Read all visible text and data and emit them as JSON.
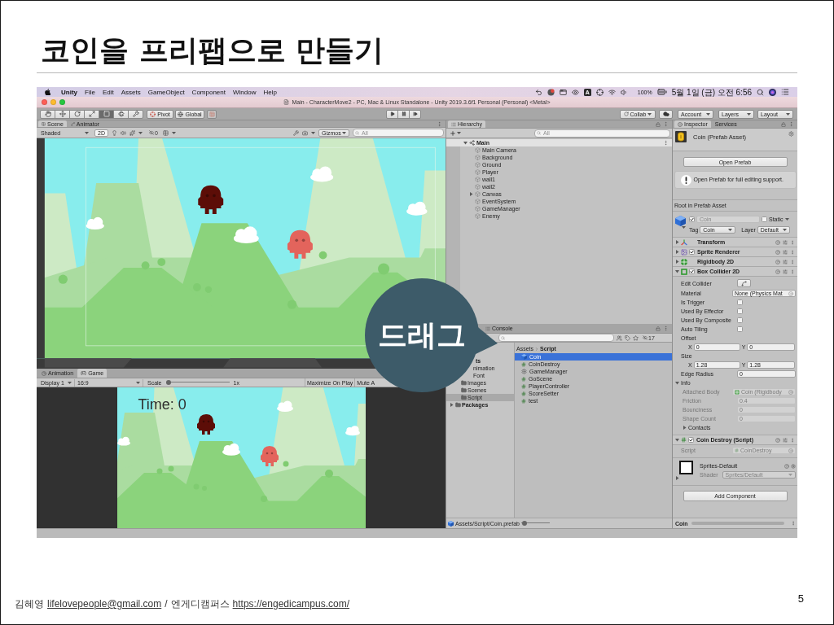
{
  "slide": {
    "title": "코인을 프리팹으로 만들기",
    "page_number": "5"
  },
  "menubar": {
    "app": "Unity",
    "menus": [
      "File",
      "Edit",
      "Assets",
      "GameObject",
      "Component",
      "Window",
      "Help"
    ],
    "input_source": "A",
    "battery": "100%",
    "clock": "5월 1일 (금) 오전 6:56"
  },
  "window": {
    "title": "Main - CharacterMove2 - PC, Mac & Linux Standalone - Unity 2019.3.6f1 Personal (Personal) <Metal>"
  },
  "toolbar": {
    "tools": [
      {
        "kind": "hand",
        "selected": false
      },
      {
        "kind": "move",
        "selected": false
      },
      {
        "kind": "rotate",
        "selected": false
      },
      {
        "kind": "scale",
        "selected": false
      },
      {
        "kind": "rect",
        "selected": true
      },
      {
        "kind": "transform",
        "selected": false
      },
      {
        "kind": "custom",
        "selected": false
      }
    ],
    "pivot": "Pivot",
    "global": "Global",
    "playback": [
      {
        "kind": "play",
        "selected": false
      },
      {
        "kind": "pause",
        "selected": false
      },
      {
        "kind": "step",
        "selected": false
      }
    ],
    "collab": "Collab",
    "account": "Account",
    "layers": "Layers",
    "layout": "Layout"
  },
  "scene": {
    "tabs": [
      {
        "label": "Scene",
        "selected": true
      },
      {
        "label": "Animator",
        "selected": false
      }
    ],
    "shading": "Shaded",
    "mode_2d": {
      "label": "2D",
      "selected": true
    },
    "hidden_count": "0",
    "gizmos": "Gizmos",
    "search": {
      "placeholder": "All"
    }
  },
  "game": {
    "tabs": [
      {
        "label": "Animation",
        "selected": false
      },
      {
        "label": "Game",
        "selected": true
      }
    ],
    "display": "Display 1",
    "aspect": "16:9",
    "scale": {
      "label": "Scale",
      "level": 0,
      "reading": "1x"
    },
    "maximize_on_play": "Maximize On Play",
    "mute": "Mute A",
    "hud": "Time: 0"
  },
  "hierarchy": {
    "tab": {
      "label": "Hierarchy",
      "selected": true
    },
    "search": {
      "placeholder": "All"
    },
    "tree": [
      {
        "label": "Main",
        "expanded": true,
        "children": [
          {
            "label": "Main Camera"
          },
          {
            "label": "Background"
          },
          {
            "label": "Ground"
          },
          {
            "label": "Player"
          },
          {
            "label": "wall1"
          },
          {
            "label": "wall2"
          },
          {
            "label": "Canvas",
            "expanded": false
          },
          {
            "label": "EventSystem"
          },
          {
            "label": "GameManager"
          },
          {
            "label": "Enemy"
          }
        ]
      }
    ]
  },
  "project": {
    "tabs": [
      {
        "label": "Console",
        "selected": false
      }
    ],
    "hidden_count": "17",
    "folders": [
      {
        "label": "ts",
        "kind": "covered",
        "selected": false,
        "children": [
          {
            "label": "nimation",
            "kind": "covered",
            "selected": false
          },
          {
            "label": "Font",
            "kind": "covered",
            "selected": false
          },
          {
            "label": "Images",
            "kind": "folder",
            "selected": false
          },
          {
            "label": "Scenes",
            "kind": "folder",
            "selected": false
          },
          {
            "label": "Script",
            "kind": "folder",
            "selected": true
          }
        ]
      },
      {
        "label": "Packages",
        "kind": "folder",
        "selected": false,
        "expanded": false
      }
    ],
    "breadcrumb": [
      "Assets",
      "Script"
    ],
    "files": [
      {
        "label": "Coin",
        "kind": "prefab",
        "selected": true
      },
      {
        "label": "CoinDestroy",
        "kind": "script",
        "selected": false
      },
      {
        "label": "GameManager",
        "kind": "manager",
        "selected": false
      },
      {
        "label": "GoScene",
        "kind": "script",
        "selected": false
      },
      {
        "label": "PlayerController",
        "kind": "script",
        "selected": false
      },
      {
        "label": "ScoreSetter",
        "kind": "script",
        "selected": false
      },
      {
        "label": "test",
        "kind": "script",
        "selected": false
      }
    ],
    "path": "Assets/Script/Coin.prefab",
    "zoom": {
      "level": 0.05
    }
  },
  "inspector": {
    "tabs": [
      {
        "label": "Inspector",
        "selected": true
      },
      {
        "label": "Services",
        "selected": false
      }
    ],
    "asset_title": "Coin (Prefab Asset)",
    "open_prefab": "Open Prefab",
    "help": "Open Prefab for full editing support.",
    "root_label": "Root in Prefab Asset",
    "object": {
      "active": true,
      "name": "Coin",
      "static": {
        "label": "Static",
        "checked": false
      },
      "tag": {
        "label": "Tag",
        "value": "Coin"
      },
      "layer": {
        "label": "Layer",
        "value": "Default"
      }
    },
    "components": [
      {
        "name": "Transform",
        "kind": "transform",
        "expanded": false
      },
      {
        "name": "Sprite Renderer",
        "kind": "sprite",
        "expanded": false,
        "enabled": true
      },
      {
        "name": "Rigidbody 2D",
        "kind": "rigidbody",
        "expanded": false
      },
      {
        "name": "Box Collider 2D",
        "kind": "collider",
        "expanded": true,
        "enabled": true,
        "properties": [
          {
            "label": "Edit Collider",
            "kind": "button",
            "disabled": false
          },
          {
            "label": "Material",
            "kind": "object",
            "value": "None (Physics Mat",
            "disabled": false
          },
          {
            "label": "Is Trigger",
            "kind": "toggle",
            "checked": false,
            "disabled": false
          },
          {
            "label": "Used By Effector",
            "kind": "toggle",
            "checked": false,
            "disabled": false
          },
          {
            "label": "Used By Composite",
            "kind": "toggle",
            "checked": false,
            "disabled": false
          },
          {
            "label": "Auto Tiling",
            "kind": "toggle",
            "checked": false,
            "disabled": false
          },
          {
            "label": "Offset",
            "kind": "vector",
            "x": {
              "label": "X",
              "value": "0"
            },
            "y": {
              "label": "Y",
              "value": "0"
            },
            "disabled": false
          },
          {
            "label": "Size",
            "kind": "vector",
            "x": {
              "label": "X",
              "value": "1.28"
            },
            "y": {
              "label": "Y",
              "value": "1.28"
            },
            "disabled": false
          },
          {
            "label": "Edge Radius",
            "kind": "float",
            "value": "0",
            "disabled": false
          },
          {
            "label": "Info",
            "kind": "foldout",
            "expanded": true,
            "disabled": false,
            "children": [
              {
                "label": "Attached Body",
                "kind": "rigidbody_ref",
                "value": "Coin (Rigidbody",
                "disabled": true
              },
              {
                "label": "Friction",
                "kind": "float",
                "value": "0.4",
                "disabled": true
              },
              {
                "label": "Bounciness",
                "kind": "float",
                "value": "0",
                "disabled": true
              },
              {
                "label": "Shape Count",
                "kind": "float",
                "value": "0",
                "disabled": true
              },
              {
                "label": "Contacts",
                "kind": "foldout",
                "expanded": false,
                "disabled": false
              }
            ]
          }
        ]
      },
      {
        "name": "Coin Destroy (Script)",
        "kind": "script",
        "expanded": true,
        "enabled": true,
        "properties": [
          {
            "label": "Script",
            "kind": "script_ref",
            "value": "CoinDestroy",
            "disabled": true
          }
        ]
      }
    ],
    "material": {
      "name": "Sprites-Default",
      "shader_label": "Shader",
      "shader": "Sprites/Default",
      "expanded": false
    },
    "add_component": "Add Component",
    "preview": "Coin"
  },
  "callout": {
    "text": "드래그"
  },
  "footer": {
    "author": "김혜영",
    "email": "lifelovepeople@gmail.com",
    "separator": "/",
    "organization": "엔게디캠퍼스",
    "website": "https://engedicampus.com/"
  }
}
